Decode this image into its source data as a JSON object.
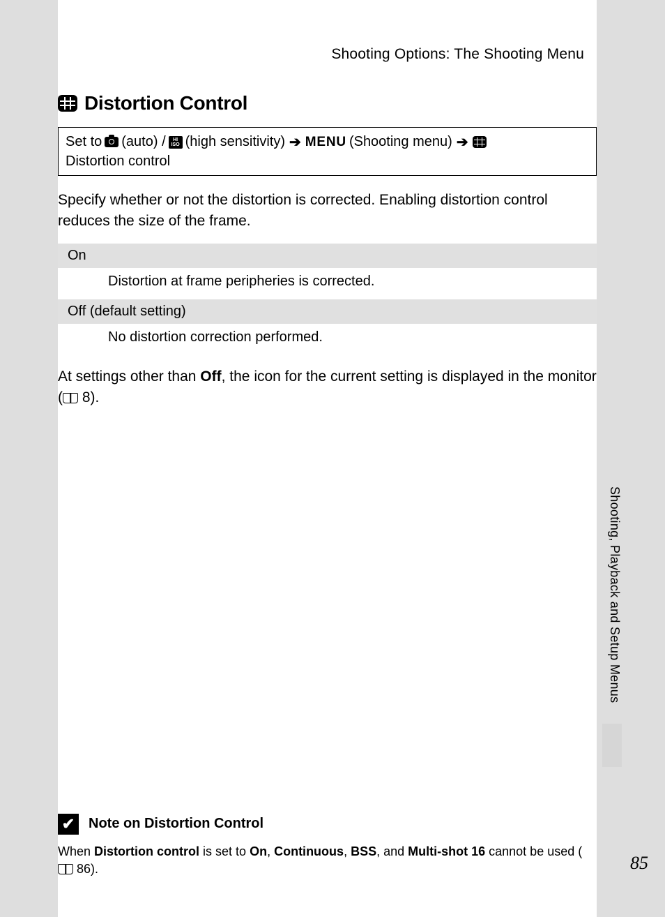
{
  "header": "Shooting Options: The Shooting Menu",
  "title": "Distortion Control",
  "breadcrumb": {
    "set_to": "Set to",
    "auto_label": "(auto) /",
    "iso_top": "HI",
    "iso_bottom": "ISO",
    "hs_label": "(high sensitivity)",
    "menu": "MENU",
    "shooting_menu": "(Shooting menu)",
    "dest": "Distortion control"
  },
  "intro": "Specify whether or not the distortion is corrected. Enabling distortion control reduces the size of the frame.",
  "options": [
    {
      "name": "On",
      "desc": "Distortion at frame peripheries is corrected."
    },
    {
      "name": "Off (default setting)",
      "desc": "No distortion correction performed."
    }
  ],
  "footer_note": {
    "pre": "At settings other than ",
    "bold": "Off",
    "mid": ", the icon for the current setting is displayed in the monitor (",
    "ref": " 8)."
  },
  "side_tab": "Shooting, Playback and Setup Menus",
  "note": {
    "check": "✔",
    "title": "Note on Distortion Control",
    "p1": "When ",
    "b1": "Distortion control",
    "p2": " is set to ",
    "b2": "On",
    "p3": ", ",
    "b3": "Continuous",
    "p4": ", ",
    "b4": "BSS",
    "p5": ", and ",
    "b5": "Multi-shot 16",
    "p6": " cannot be used (",
    "ref": " 86)."
  },
  "page_number": "85"
}
